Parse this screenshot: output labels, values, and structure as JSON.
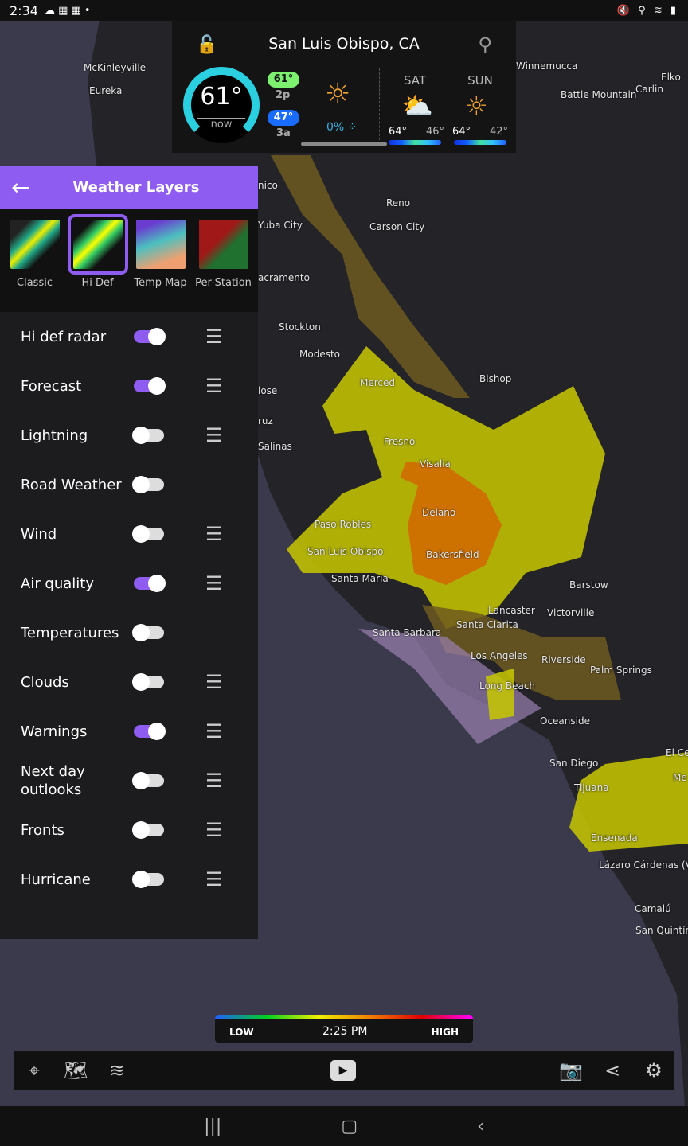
{
  "status": {
    "time": "2:34",
    "icons": "☁ ▦ ▦ •",
    "right_icons": "🔇 ⚲ ≋ ▮"
  },
  "weather": {
    "location": "San Luis Obispo, CA",
    "current_temp": "61°",
    "now_label": "now",
    "high": {
      "temp": "61°",
      "time": "2p"
    },
    "low": {
      "temp": "47°",
      "time": "3a"
    },
    "precip": "0%",
    "forecast": [
      {
        "day": "SAT",
        "high": "64°",
        "low": "46°",
        "icon": "partly-cloudy-icon"
      },
      {
        "day": "SUN",
        "high": "64°",
        "low": "42°",
        "icon": "sun-icon"
      }
    ]
  },
  "panel": {
    "title": "Weather Layers",
    "styles": [
      {
        "label": "Classic",
        "selected": false
      },
      {
        "label": "Hi Def",
        "selected": true
      },
      {
        "label": "Temp Map",
        "selected": false
      },
      {
        "label": "Per-Station",
        "selected": false
      }
    ],
    "layers": [
      {
        "label": "Hi def radar",
        "on": true,
        "settings": true
      },
      {
        "label": "Forecast",
        "on": true,
        "settings": true
      },
      {
        "label": "Lightning",
        "on": false,
        "settings": true
      },
      {
        "label": "Road Weather",
        "on": false,
        "settings": false
      },
      {
        "label": "Wind",
        "on": false,
        "settings": true
      },
      {
        "label": "Air quality",
        "on": true,
        "settings": true
      },
      {
        "label": "Temperatures",
        "on": false,
        "settings": false
      },
      {
        "label": "Clouds",
        "on": false,
        "settings": true
      },
      {
        "label": "Warnings",
        "on": true,
        "settings": true
      },
      {
        "label": "Next day outlooks",
        "on": false,
        "settings": true
      },
      {
        "label": "Fronts",
        "on": false,
        "settings": true
      },
      {
        "label": "Hurricane",
        "on": false,
        "settings": true
      }
    ]
  },
  "legend": {
    "low": "LOW",
    "time": "2:25 PM",
    "high": "HIGH"
  },
  "cities": [
    "McKinleyville",
    "Eureka",
    "Winnemucca",
    "Elko",
    "Carlin",
    "Battle Mountain",
    "Reno",
    "Carson City",
    "nico",
    "Yuba City",
    "acramento",
    "Stockton",
    "Modesto",
    "Merced",
    "Bishop",
    "lose",
    "ruz",
    "Salinas",
    "Fresno",
    "Visalia",
    "Delano",
    "Paso Robles",
    "Bakersfield",
    "San Luis Obispo",
    "Santa Maria",
    "Barstow",
    "Lancaster",
    "Victorville",
    "Santa Barbara",
    "Santa Clarita",
    "Los Angeles",
    "Riverside",
    "Palm Springs",
    "Long Beach",
    "Oceanside",
    "San Diego",
    "Tijuana",
    "El Cen",
    "Me",
    "Ensenada",
    "Lázaro Cárdenas (Valle",
    "Camalú",
    "San Quintín"
  ],
  "colors": {
    "accent": "#8e5cf0",
    "aq_moderate": "#c8c800",
    "aq_usg": "#d06a00",
    "warning_purple": "#9a80b0"
  }
}
